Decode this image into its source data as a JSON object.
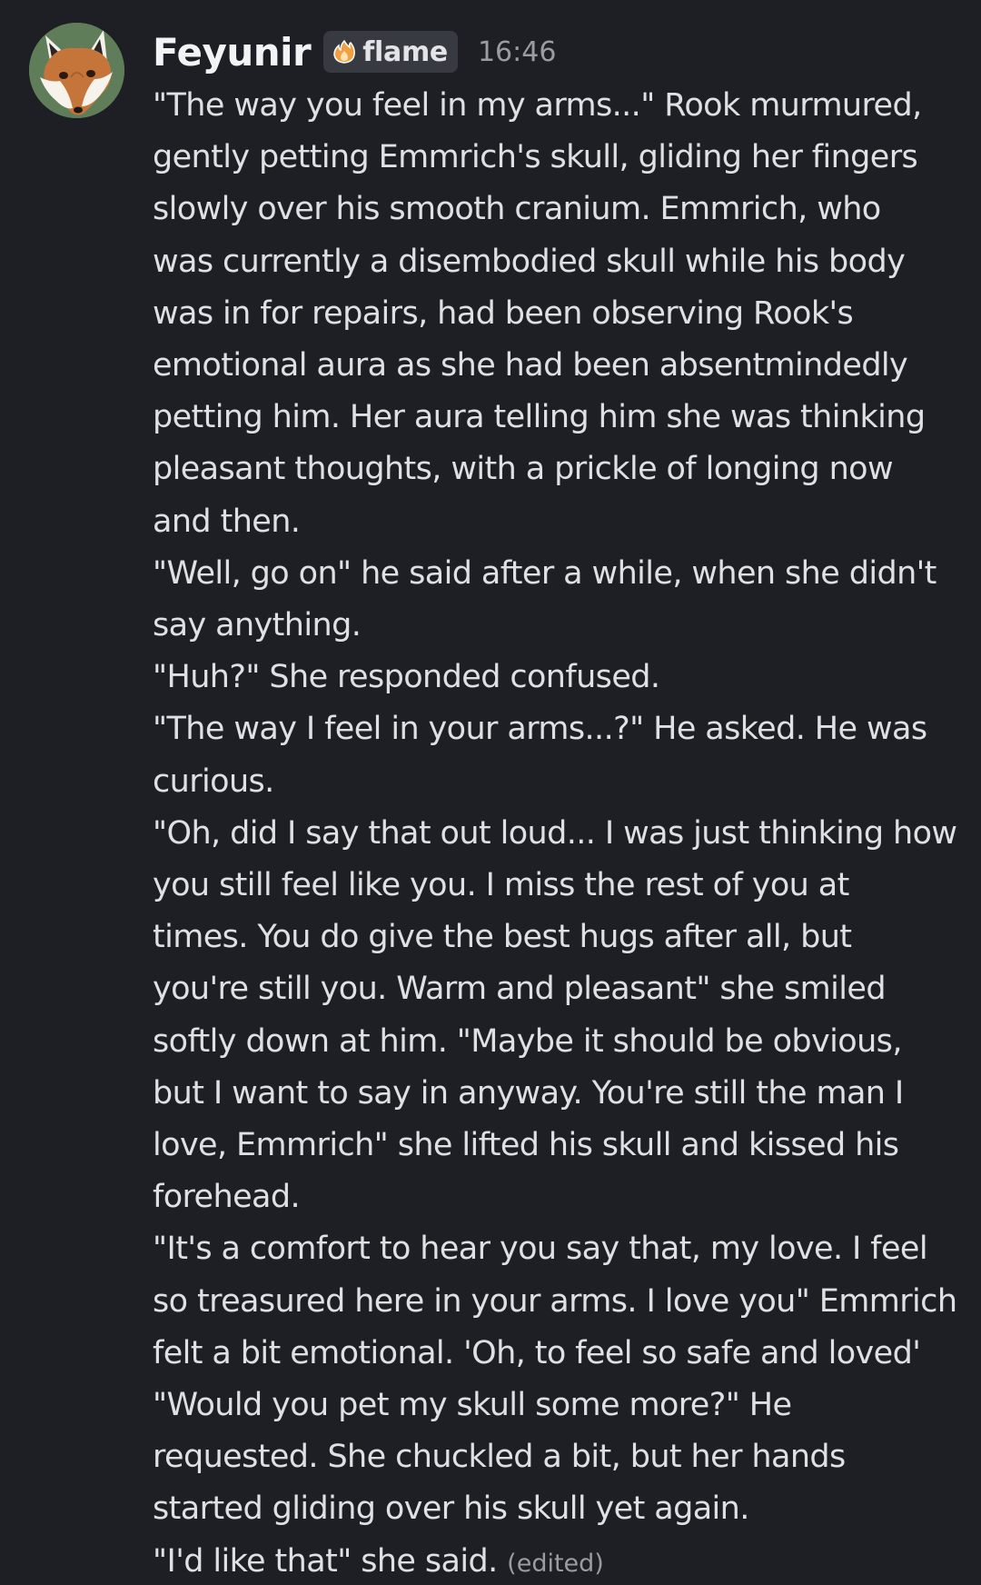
{
  "message": {
    "author": "Feyunir",
    "tag": {
      "label": "flame",
      "icon": "flame-icon"
    },
    "timestamp": "16:46",
    "avatar_icon": "fox-avatar-icon",
    "edited_label": "(edited)",
    "lines": [
      "\"The way you feel in my arms...\"  Rook murmured,",
      "gently petting Emmrich's skull, gliding her fingers",
      "slowly over his smooth cranium. Emmrich, who",
      "was currently a disembodied skull while his body",
      "was in for repairs, had been observing Rook's",
      "emotional aura as she had been absentmindedly",
      "petting him. Her aura telling him she was thinking",
      "pleasant thoughts, with a prickle of longing now",
      "and then.",
      "\"Well, go on\" he said after a while, when she didn't",
      "say anything.",
      "\"Huh?\" She responded confused.",
      "\"The way I feel in your arms...?\" He asked. He was",
      "curious.",
      "\"Oh, did I say that out loud... I was just thinking how",
      "you still feel like you. I miss the rest of you at",
      "times. You do give the best hugs after all, but",
      "you're still you. Warm and pleasant\" she smiled",
      "softly down at him. \"Maybe it should be obvious,",
      "but I want to say in anyway. You're still the man I",
      "love, Emmrich\" she lifted his skull and kissed his",
      "forehead.",
      "\"It's a comfort to hear you say that, my love. I feel",
      "so treasured here in your arms. I love you\" Emmrich",
      "felt a bit emotional. 'Oh, to feel so safe and loved'",
      "\"Would you pet my skull some more?\" He",
      "requested.  She chuckled a bit, but her hands",
      "started gliding over his skull yet again.",
      "\"I'd like that\" she said."
    ]
  },
  "colors": {
    "background": "#1e1f24",
    "text": "#dfe0e4",
    "username": "#f2f3f5",
    "muted": "#9b9ca3",
    "tag_background": "#383a42",
    "avatar_background": "#5f7d58",
    "flame_orange": "#f0a040"
  }
}
